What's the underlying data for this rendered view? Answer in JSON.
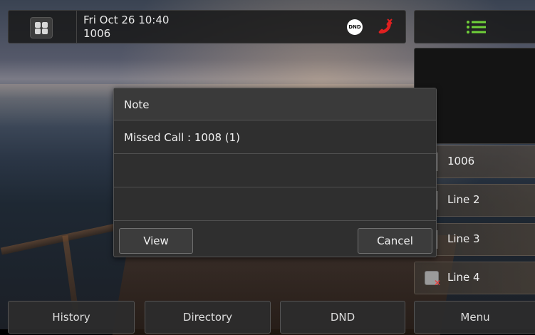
{
  "status_bar": {
    "datetime": "Fri Oct 26 10:40",
    "extension": "1006",
    "dnd_badge": "DND"
  },
  "icons": {
    "home": "grid-icon",
    "dnd": "dnd-icon",
    "missed_call": "missed-call-icon",
    "menu": "list-icon",
    "line4": "line-unregistered-icon"
  },
  "colors": {
    "missed_call_red": "#e02020",
    "menu_icon_green": "#6fcf3a"
  },
  "modal": {
    "title": "Note",
    "rows": [
      "Missed Call : 1008 (1)",
      "",
      ""
    ],
    "view_label": "View",
    "cancel_label": "Cancel"
  },
  "line_keys": [
    {
      "label": "1006"
    },
    {
      "label": "Line 2"
    },
    {
      "label": "Line 3"
    },
    {
      "label": "Line 4"
    }
  ],
  "softkeys": [
    {
      "label": "History"
    },
    {
      "label": "Directory"
    },
    {
      "label": "DND"
    },
    {
      "label": "Menu"
    }
  ]
}
